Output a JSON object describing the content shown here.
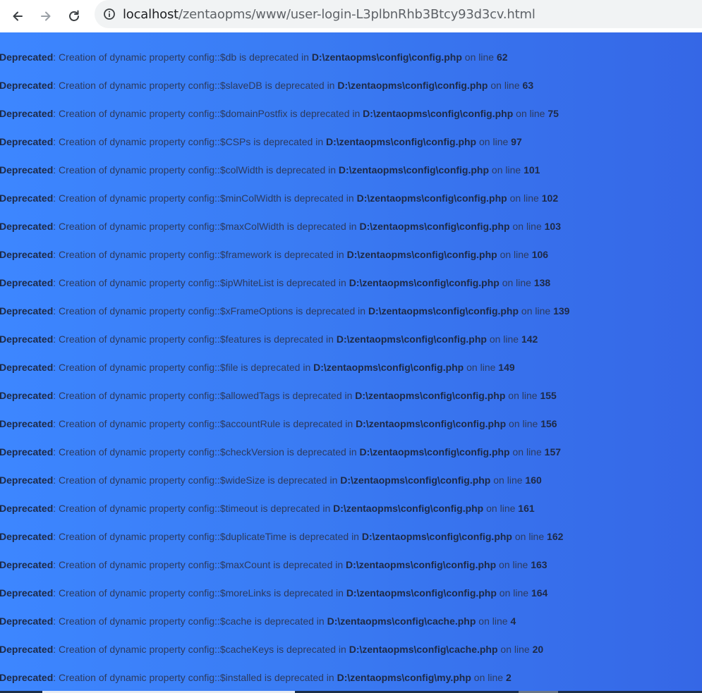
{
  "browser": {
    "url_host": "localhost",
    "url_path": "/zentaopms/www/user-login-L3plbnRhb3Btcy93d3cv.html"
  },
  "messages": [
    {
      "label": "Deprecated",
      "text": ": Creation of dynamic property config::$db is deprecated in ",
      "file": "D:\\zentaopms\\config\\config.php",
      "on": " on line ",
      "line": "62"
    },
    {
      "label": "Deprecated",
      "text": ": Creation of dynamic property config::$slaveDB is deprecated in ",
      "file": "D:\\zentaopms\\config\\config.php",
      "on": " on line ",
      "line": "63"
    },
    {
      "label": "Deprecated",
      "text": ": Creation of dynamic property config::$domainPostfix is deprecated in ",
      "file": "D:\\zentaopms\\config\\config.php",
      "on": " on line ",
      "line": "75"
    },
    {
      "label": "Deprecated",
      "text": ": Creation of dynamic property config::$CSPs is deprecated in ",
      "file": "D:\\zentaopms\\config\\config.php",
      "on": " on line ",
      "line": "97"
    },
    {
      "label": "Deprecated",
      "text": ": Creation of dynamic property config::$colWidth is deprecated in ",
      "file": "D:\\zentaopms\\config\\config.php",
      "on": " on line ",
      "line": "101"
    },
    {
      "label": "Deprecated",
      "text": ": Creation of dynamic property config::$minColWidth is deprecated in ",
      "file": "D:\\zentaopms\\config\\config.php",
      "on": " on line ",
      "line": "102"
    },
    {
      "label": "Deprecated",
      "text": ": Creation of dynamic property config::$maxColWidth is deprecated in ",
      "file": "D:\\zentaopms\\config\\config.php",
      "on": " on line ",
      "line": "103"
    },
    {
      "label": "Deprecated",
      "text": ": Creation of dynamic property config::$framework is deprecated in ",
      "file": "D:\\zentaopms\\config\\config.php",
      "on": " on line ",
      "line": "106"
    },
    {
      "label": "Deprecated",
      "text": ": Creation of dynamic property config::$ipWhiteList is deprecated in ",
      "file": "D:\\zentaopms\\config\\config.php",
      "on": " on line ",
      "line": "138"
    },
    {
      "label": "Deprecated",
      "text": ": Creation of dynamic property config::$xFrameOptions is deprecated in ",
      "file": "D:\\zentaopms\\config\\config.php",
      "on": " on line ",
      "line": "139"
    },
    {
      "label": "Deprecated",
      "text": ": Creation of dynamic property config::$features is deprecated in ",
      "file": "D:\\zentaopms\\config\\config.php",
      "on": " on line ",
      "line": "142"
    },
    {
      "label": "Deprecated",
      "text": ": Creation of dynamic property config::$file is deprecated in ",
      "file": "D:\\zentaopms\\config\\config.php",
      "on": " on line ",
      "line": "149"
    },
    {
      "label": "Deprecated",
      "text": ": Creation of dynamic property config::$allowedTags is deprecated in ",
      "file": "D:\\zentaopms\\config\\config.php",
      "on": " on line ",
      "line": "155"
    },
    {
      "label": "Deprecated",
      "text": ": Creation of dynamic property config::$accountRule is deprecated in ",
      "file": "D:\\zentaopms\\config\\config.php",
      "on": " on line ",
      "line": "156"
    },
    {
      "label": "Deprecated",
      "text": ": Creation of dynamic property config::$checkVersion is deprecated in ",
      "file": "D:\\zentaopms\\config\\config.php",
      "on": " on line ",
      "line": "157"
    },
    {
      "label": "Deprecated",
      "text": ": Creation of dynamic property config::$wideSize is deprecated in ",
      "file": "D:\\zentaopms\\config\\config.php",
      "on": " on line ",
      "line": "160"
    },
    {
      "label": "Deprecated",
      "text": ": Creation of dynamic property config::$timeout is deprecated in ",
      "file": "D:\\zentaopms\\config\\config.php",
      "on": " on line ",
      "line": "161"
    },
    {
      "label": "Deprecated",
      "text": ": Creation of dynamic property config::$duplicateTime is deprecated in ",
      "file": "D:\\zentaopms\\config\\config.php",
      "on": " on line ",
      "line": "162"
    },
    {
      "label": "Deprecated",
      "text": ": Creation of dynamic property config::$maxCount is deprecated in ",
      "file": "D:\\zentaopms\\config\\config.php",
      "on": " on line ",
      "line": "163"
    },
    {
      "label": "Deprecated",
      "text": ": Creation of dynamic property config::$moreLinks is deprecated in ",
      "file": "D:\\zentaopms\\config\\config.php",
      "on": " on line ",
      "line": "164"
    },
    {
      "label": "Deprecated",
      "text": ": Creation of dynamic property config::$cache is deprecated in ",
      "file": "D:\\zentaopms\\config\\cache.php",
      "on": " on line ",
      "line": "4"
    },
    {
      "label": "Deprecated",
      "text": ": Creation of dynamic property config::$cacheKeys is deprecated in ",
      "file": "D:\\zentaopms\\config\\cache.php",
      "on": " on line ",
      "line": "20"
    },
    {
      "label": "Deprecated",
      "text": ": Creation of dynamic property config::$installed is deprecated in ",
      "file": "D:\\zentaopms\\config\\my.php",
      "on": " on line ",
      "line": "2"
    }
  ]
}
